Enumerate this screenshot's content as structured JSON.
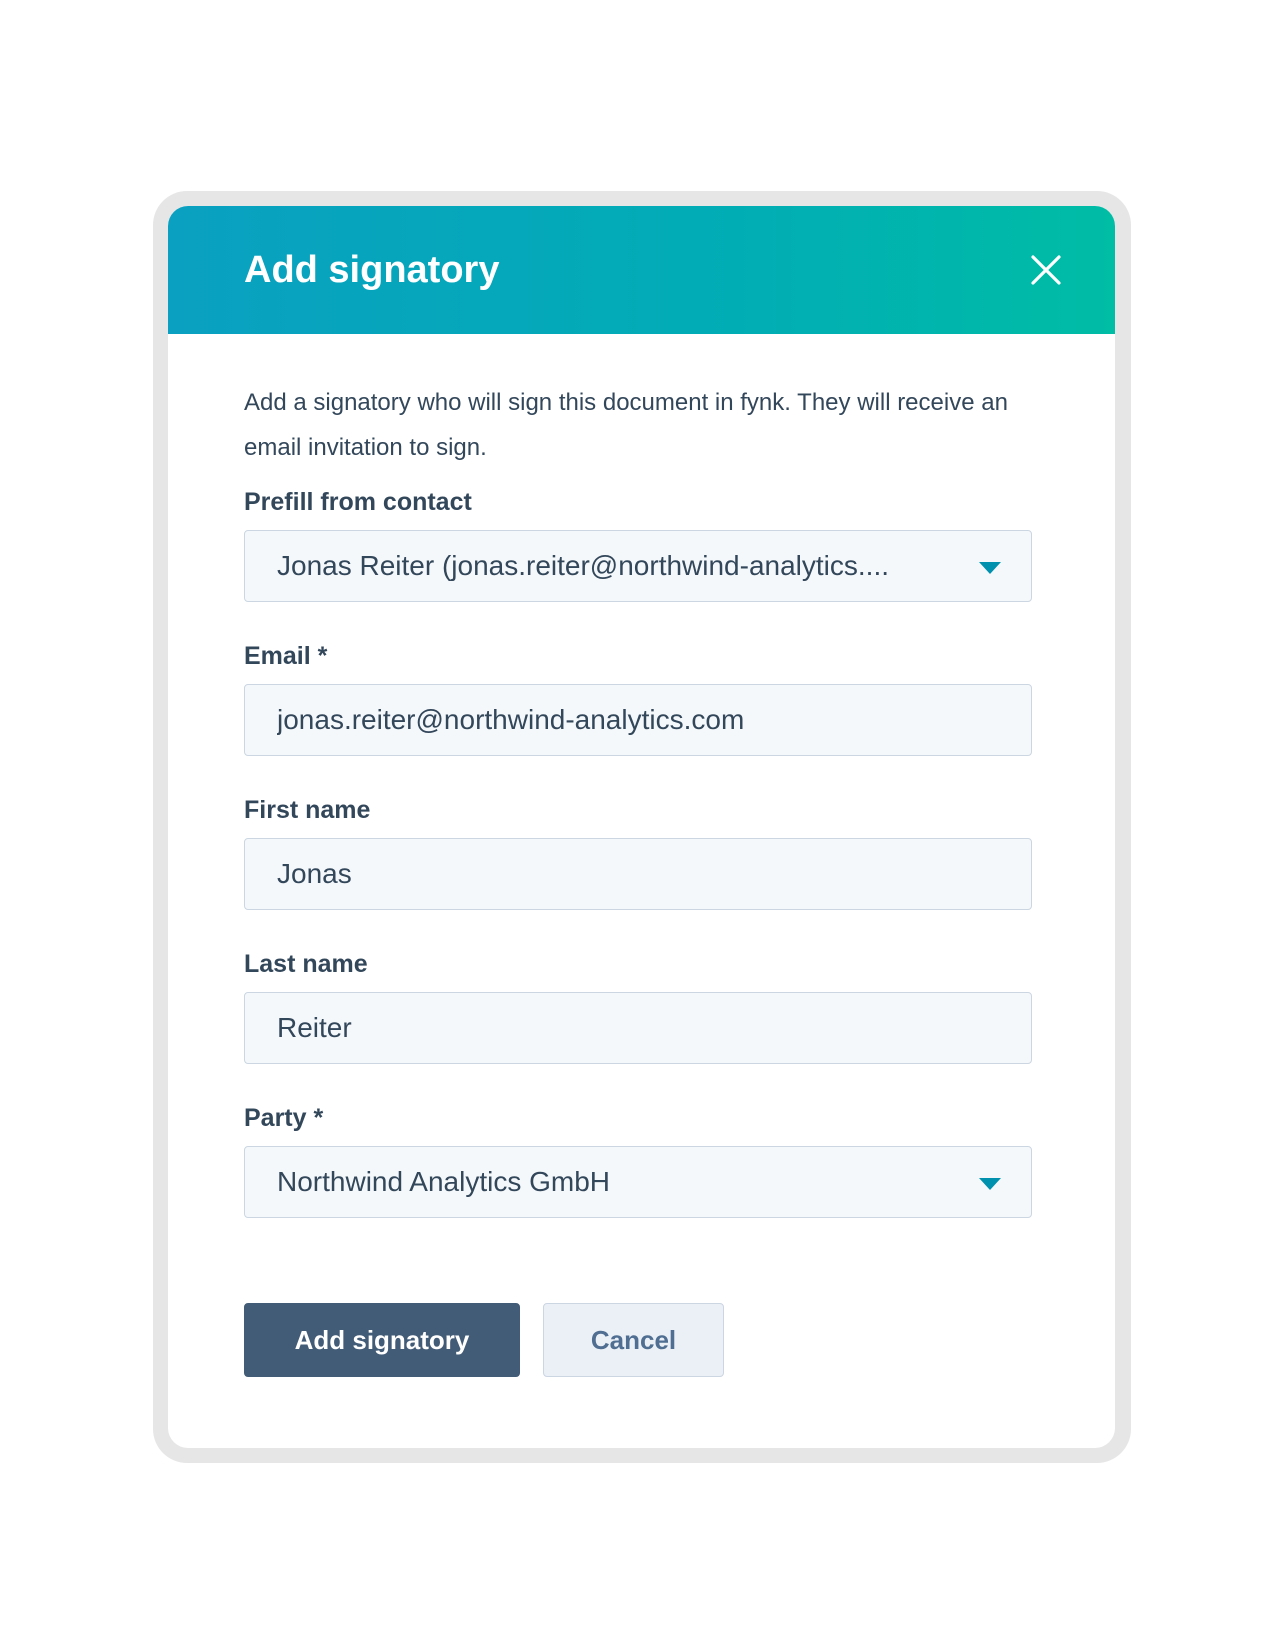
{
  "modal": {
    "title": "Add signatory",
    "description": "Add a signatory who will sign this document in fynk. They will receive an email invitation to sign."
  },
  "fields": {
    "prefill": {
      "label": "Prefill from contact",
      "value": "Jonas Reiter (jonas.reiter@northwind-analytics...."
    },
    "email": {
      "label": "Email *",
      "value": "jonas.reiter@northwind-analytics.com"
    },
    "first_name": {
      "label": "First name",
      "value": "Jonas"
    },
    "last_name": {
      "label": "Last name",
      "value": "Reiter"
    },
    "party": {
      "label": "Party *",
      "value": "Northwind Analytics GmbH"
    }
  },
  "buttons": {
    "submit_label": "Add signatory",
    "cancel_label": "Cancel"
  },
  "icons": {
    "close": "close-icon",
    "dropdown": "chevron-down-icon"
  },
  "colors": {
    "header_gradient_start": "#0aa0c1",
    "header_gradient_end": "#00bda5",
    "primary_button": "#425b76",
    "caret": "#0091ae"
  }
}
